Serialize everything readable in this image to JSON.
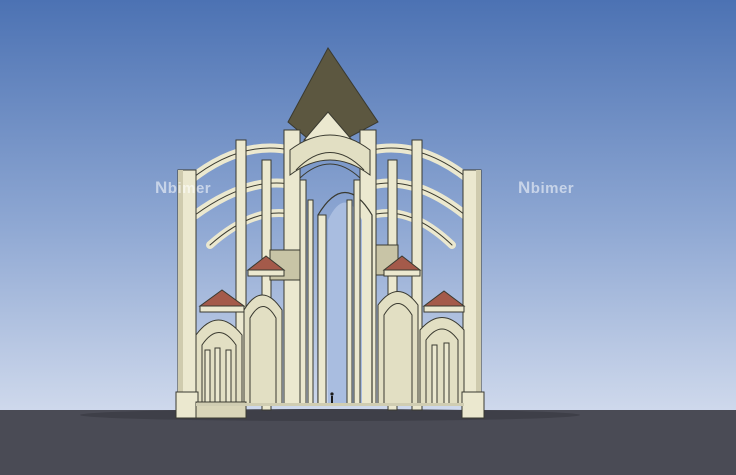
{
  "image": {
    "subject": "cathedral-cross-section-3d-model",
    "watermark_left": "bimer",
    "watermark_right": "bimer",
    "watermark_mark": "N"
  },
  "colors": {
    "sky_top": "#4d74b4",
    "sky_bottom": "#c7d4ea",
    "ground": "#4a4b55",
    "stone": "#ebe8cf",
    "stone_shadow": "#cfcbae",
    "outline": "#3a3a30",
    "roof": "#5c5740",
    "tile": "#a45a4a"
  }
}
